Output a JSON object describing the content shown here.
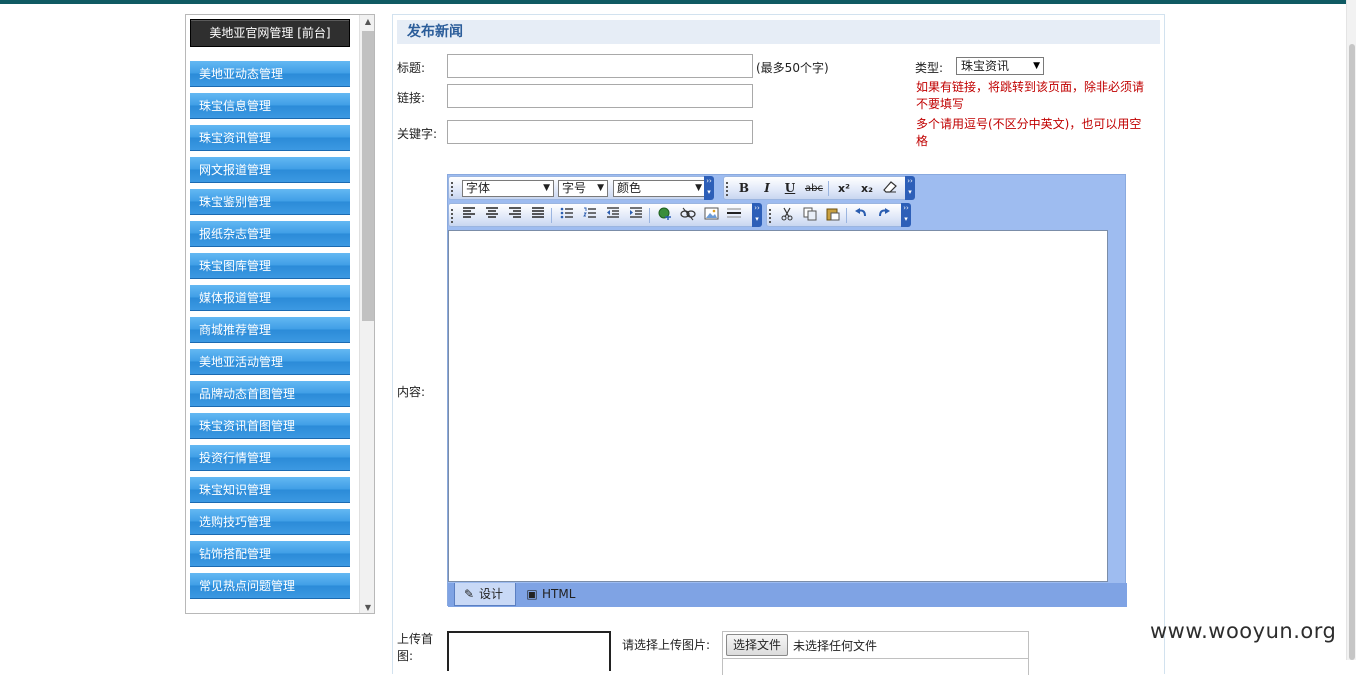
{
  "menu": {
    "header": "美地亚官网管理 [前台]",
    "items": [
      "美地亚动态管理",
      "珠宝信息管理",
      "珠宝资讯管理",
      "网文报道管理",
      "珠宝鉴别管理",
      "报纸杂志管理",
      "珠宝图库管理",
      "媒体报道管理",
      "商城推荐管理",
      "美地亚活动管理",
      "品牌动态首图管理",
      "珠宝资讯首图管理",
      "投资行情管理",
      "珠宝知识管理",
      "选购技巧管理",
      "钻饰搭配管理",
      "常见热点问题管理"
    ]
  },
  "form": {
    "title": "发布新闻",
    "title_label": "标题:",
    "title_value": "",
    "title_hint": "(最多50个字)",
    "link_label": "链接:",
    "link_value": "",
    "keywords_label": "关键字:",
    "keywords_value": "",
    "type_label": "类型:",
    "type_value": "珠宝资讯",
    "link_note": "如果有链接，将跳转到该页面，除非必须请不要填写",
    "keywords_note": "多个请用逗号(不区分中英文)，也可以用空格",
    "content_label": "内容:",
    "upload_label": "上传首图:",
    "upload_prompt": "请选择上传图片:",
    "file_button": "选择文件",
    "file_status": "未选择任何文件"
  },
  "editor": {
    "font_select": "字体",
    "size_select": "字号",
    "color_select": "颜色",
    "bold": "B",
    "italic": "I",
    "underline": "U",
    "strike": "abc",
    "superscript": "x²",
    "subscript": "x₂",
    "tab_design": "设计",
    "tab_html": "HTML"
  },
  "watermark": "www.wooyun.org",
  "colors": {
    "menu_item": "#3f9ee6",
    "menu_header": "#2f2f2f",
    "editor_frame": "#9ebcf0",
    "note_red": "#c00000",
    "title_text": "#2b5d9a",
    "top_bar": "#0f5a63"
  }
}
